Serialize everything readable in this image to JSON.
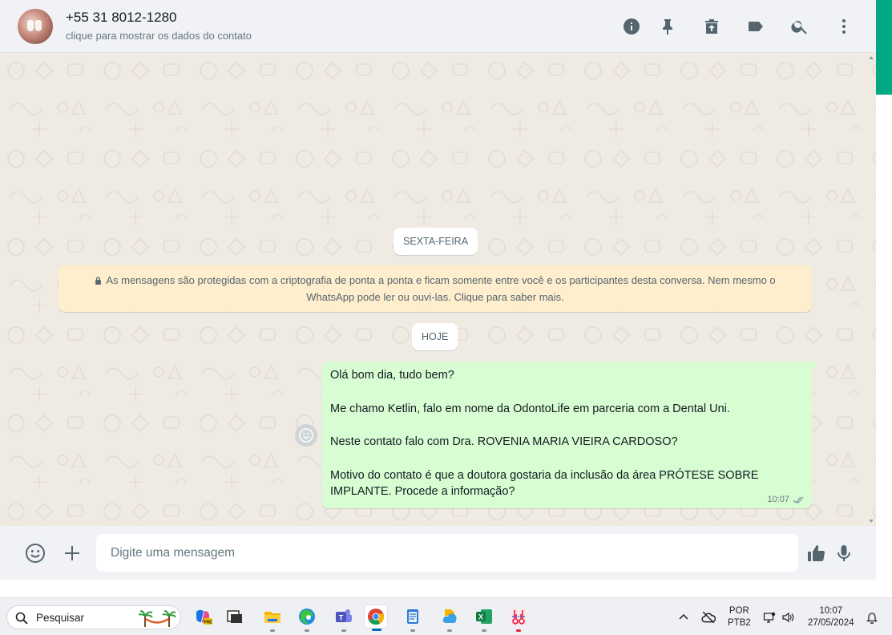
{
  "header": {
    "contact_name": "+55 31 8012-1280",
    "contact_subtitle": "clique para mostrar os dados do contato",
    "icons": [
      "info-icon",
      "pin-icon",
      "archive-icon",
      "label-icon",
      "search-icon",
      "menu-icon"
    ]
  },
  "conversation": {
    "date_chip_1": "SEXTA-FEIRA",
    "encryption_notice": "As mensagens são protegidas com a criptografia de ponta a ponta e ficam somente entre você e os participantes desta conversa. Nem mesmo o WhatsApp pode ler ou ouvi-las. Clique para saber mais.",
    "date_chip_2": "HOJE",
    "message": {
      "paragraphs": [
        "Olá bom dia, tudo bem?",
        "Me chamo Ketlin, falo em nome da OdontoLife em parceria com a Dental Uni.",
        "Neste contato falo com Dra. ROVENIA MARIA VIEIRA CARDOSO?",
        "Motivo do contato é que a doutora gostaria da inclusão da área PRÓTESE SOBRE IMPLANTE. Procede a informação?"
      ],
      "time": "10:07",
      "status": "delivered"
    }
  },
  "composer": {
    "placeholder": "Digite uma mensagem"
  },
  "taskbar": {
    "search_label": "Pesquisar",
    "apps": [
      "copilot-icon",
      "task-view-icon",
      "file-explorer-icon",
      "edge-icon",
      "teams-icon",
      "chrome-icon",
      "notepad-icon",
      "photos-icon",
      "excel-icon",
      "snipping-tool-icon"
    ],
    "active_app": "chrome-icon",
    "language_top": "POR",
    "language_bottom": "PTB2",
    "clock_time": "10:07",
    "clock_date": "27/05/2024"
  },
  "colors": {
    "accent": "#00a884",
    "bubble_out": "#d9fdd3",
    "notice_bg": "#ffeecd",
    "wallpaper": "#efeae2"
  }
}
